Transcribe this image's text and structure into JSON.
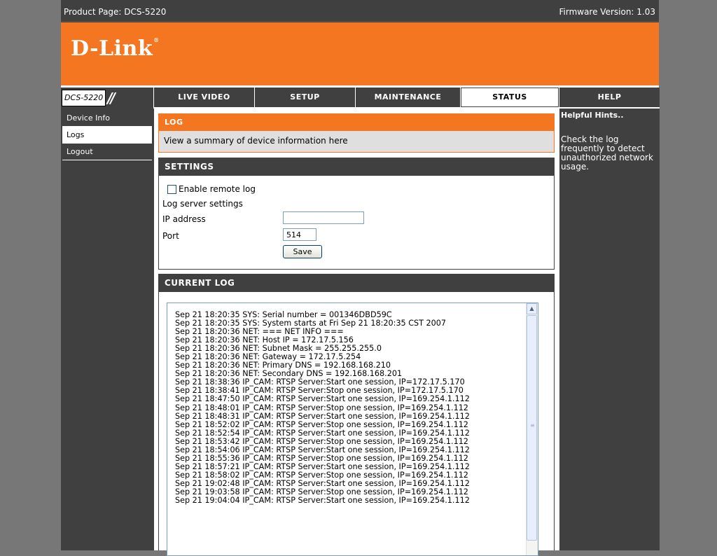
{
  "topbar": {
    "product": "Product Page: DCS-5220",
    "firmware": "Firmware Version: 1.03"
  },
  "brand": {
    "logo": "D-Link",
    "reg": "®"
  },
  "nav": {
    "model": "DCS-5220",
    "tabs": [
      {
        "label": "LIVE VIDEO"
      },
      {
        "label": "SETUP"
      },
      {
        "label": "MAINTENANCE"
      },
      {
        "label": "STATUS"
      },
      {
        "label": "HELP"
      }
    ]
  },
  "sidebar": {
    "items": [
      {
        "label": "Device Info"
      },
      {
        "label": "Logs"
      },
      {
        "label": "Logout"
      }
    ]
  },
  "log": {
    "title": "LOG",
    "description": "View a summary of device information here"
  },
  "settings": {
    "title": "SETTINGS",
    "enable_label": "Enable remote log",
    "server_label": "Log server settings",
    "ip_label": "IP address",
    "ip_value": "",
    "port_label": "Port",
    "port_value": "514",
    "save_label": "Save"
  },
  "current_log": {
    "title": "CURRENT LOG",
    "lines": "Sep 21 18:20:35 SYS: Serial number = 001346DBD59C\nSep 21 18:20:35 SYS: System starts at Fri Sep 21 18:20:35 CST 2007\nSep 21 18:20:36 NET: === NET INFO ===\nSep 21 18:20:36 NET: Host IP = 172.17.5.156\nSep 21 18:20:36 NET: Subnet Mask = 255.255.255.0\nSep 21 18:20:36 NET: Gateway = 172.17.5.254\nSep 21 18:20:36 NET: Primary DNS = 192.168.168.210\nSep 21 18:20:36 NET: Secondary DNS = 192.168.168.201\nSep 21 18:38:36 IP_CAM: RTSP Server:Start one session, IP=172.17.5.170\nSep 21 18:38:41 IP_CAM: RTSP Server:Stop one session, IP=172.17.5.170\nSep 21 18:47:50 IP_CAM: RTSP Server:Start one session, IP=169.254.1.112\nSep 21 18:48:01 IP_CAM: RTSP Server:Stop one session, IP=169.254.1.112\nSep 21 18:48:31 IP_CAM: RTSP Server:Start one session, IP=169.254.1.112\nSep 21 18:52:02 IP_CAM: RTSP Server:Stop one session, IP=169.254.1.112\nSep 21 18:52:54 IP_CAM: RTSP Server:Start one session, IP=169.254.1.112\nSep 21 18:53:42 IP_CAM: RTSP Server:Stop one session, IP=169.254.1.112\nSep 21 18:54:06 IP_CAM: RTSP Server:Start one session, IP=169.254.1.112\nSep 21 18:55:36 IP_CAM: RTSP Server:Stop one session, IP=169.254.1.112\nSep 21 18:57:21 IP_CAM: RTSP Server:Start one session, IP=169.254.1.112\nSep 21 18:58:02 IP_CAM: RTSP Server:Stop one session, IP=169.254.1.112\nSep 21 19:02:48 IP_CAM: RTSP Server:Start one session, IP=169.254.1.112\nSep 21 19:03:58 IP_CAM: RTSP Server:Stop one session, IP=169.254.1.112\nSep 21 19:04:04 IP_CAM: RTSP Server:Start one session, IP=169.254.1.112"
  },
  "help": {
    "title": "Helpful Hints..",
    "text": "Check the log frequently to detect unauthorized network usage."
  },
  "colors": {
    "accent": "#f57620",
    "dark": "#404040",
    "outer": "#777777"
  },
  "icons": {
    "scroll_up": "chevron-up-icon",
    "grip": "scroll-grip-icon"
  }
}
